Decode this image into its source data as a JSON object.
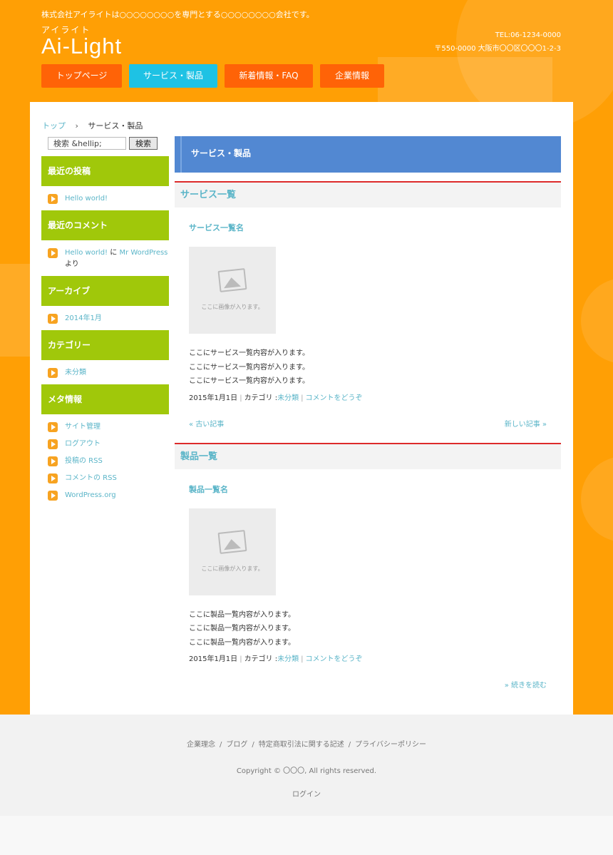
{
  "site": {
    "tagline": "株式会社アイライトは○○○○○○○○を専門とする○○○○○○○○会社です。",
    "logo_kana": "アイライト",
    "logo_word": "Ai-Light",
    "tel": "TEL:06-1234-0000",
    "address": "〒550-0000 大阪市〇〇区〇〇〇1-2-3"
  },
  "nav": [
    {
      "label": "トップページ",
      "active": false
    },
    {
      "label": "サービス・製品",
      "active": true
    },
    {
      "label": "新着情報・FAQ",
      "active": false
    },
    {
      "label": "企業情報",
      "active": false
    }
  ],
  "breadcrumb": {
    "home": "トップ",
    "separator": "›",
    "current": "サービス・製品"
  },
  "search": {
    "value": "検索 &hellip;",
    "button": "検索"
  },
  "widgets": {
    "recent_posts": {
      "title": "最近の投稿",
      "items": [
        "Hello world!"
      ]
    },
    "recent_comments": {
      "title": "最近のコメント",
      "link": "Hello world!",
      "connector": "に",
      "author": "Mr WordPress",
      "suffix": "より"
    },
    "archives": {
      "title": "アーカイブ",
      "items": [
        "2014年1月"
      ]
    },
    "categories": {
      "title": "カテゴリー",
      "items": [
        "未分類"
      ]
    },
    "meta": {
      "title": "メタ情報",
      "items": [
        "サイト管理",
        "ログアウト",
        "投稿の RSS",
        "コメントの RSS",
        "WordPress.org"
      ]
    }
  },
  "main": {
    "page_title": "サービス・製品",
    "sections": [
      {
        "heading": "サービス一覧",
        "entry_title": "サービス一覧名",
        "image_caption": "ここに画像が入ります。",
        "lines": [
          "ここにサービス一覧内容が入ります。",
          "ここにサービス一覧内容が入ります。",
          "ここにサービス一覧内容が入ります。"
        ],
        "date": "2015年1月1日",
        "category_label": "カテゴリ :",
        "category": "未分類",
        "comment_link": "コメントをどうぞ",
        "prev": "« 古い記事",
        "next": "新しい記事 »"
      },
      {
        "heading": "製品一覧",
        "entry_title": "製品一覧名",
        "image_caption": "ここに画像が入ります。",
        "lines": [
          "ここに製品一覧内容が入ります。",
          "ここに製品一覧内容が入ります。",
          "ここに製品一覧内容が入ります。"
        ],
        "date": "2015年1月1日",
        "category_label": "カテゴリ :",
        "category": "未分類",
        "comment_link": "コメントをどうぞ",
        "more": "» 続きを読む"
      }
    ]
  },
  "footer": {
    "links": [
      "企業理念",
      "ブログ",
      "特定商取引法に関する記述",
      "プライバシーポリシー"
    ],
    "separator": "/",
    "copyright": "Copyright © 〇〇〇, All rights reserved.",
    "login": "ログイン"
  },
  "colors": {
    "background_orange": "#ff9f05",
    "nav_orange": "#ff6307",
    "nav_active": "#1ec2e4",
    "widget_green": "#a0c80a",
    "title_blue": "#5288d2",
    "section_red": "#dd2b2b",
    "link_teal": "#5bb5c8"
  }
}
